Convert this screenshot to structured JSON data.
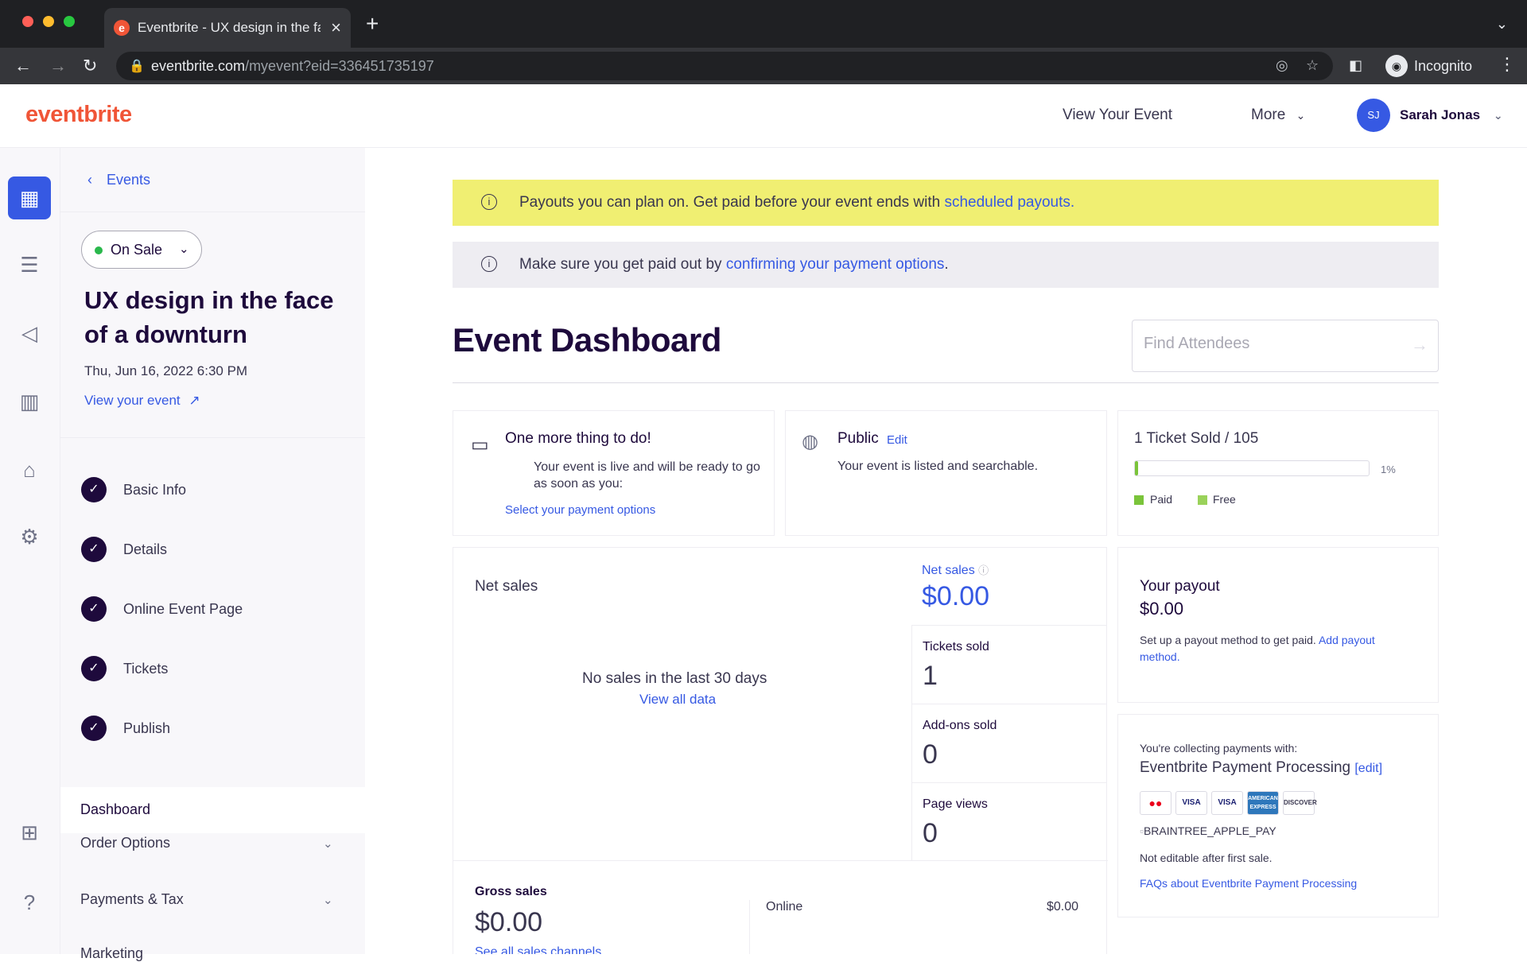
{
  "browser": {
    "tab_title": "Eventbrite - UX design in the face of a downturn",
    "tab_favicon": "e",
    "url_domain": "eventbrite.com",
    "url_path": "/myevent?eid=336451735197",
    "incognito_label": "Incognito"
  },
  "header": {
    "logo": "eventbrite",
    "view_event": "View Your Event",
    "more": "More",
    "user_initials": "SJ",
    "user_name": "Sarah Jonas"
  },
  "sidebar": {
    "back_label": "Events",
    "status": "On Sale",
    "event_title": "UX design in the face of a downturn",
    "event_date": "Thu, Jun 16, 2022 6:30 PM",
    "view_event_link": "View your event",
    "steps": [
      "Basic Info",
      "Details",
      "Online Event Page",
      "Tickets",
      "Publish"
    ],
    "nav": {
      "dashboard": "Dashboard",
      "order_options": "Order Options",
      "payments_tax": "Payments & Tax",
      "marketing": "Marketing"
    }
  },
  "banners": {
    "payouts_text": "Payouts you can plan on. Get paid before your event ends with ",
    "payouts_link": "scheduled payouts.",
    "confirm_text": "Make sure you get paid out by ",
    "confirm_link": "confirming your payment options",
    "confirm_end": "."
  },
  "dashboard": {
    "title": "Event Dashboard",
    "find_placeholder": "Find Attendees"
  },
  "todo_card": {
    "title": "One more thing to do!",
    "body": "Your event is live and will be ready to go as soon as you:",
    "link": "Select your payment options"
  },
  "public_card": {
    "title": "Public",
    "edit": "Edit",
    "body": "Your event is listed and searchable."
  },
  "tickets_card": {
    "title": "1 Ticket Sold / 105",
    "percent_label": "1%",
    "sold_fraction": 0.01,
    "legend_paid": "Paid",
    "legend_free": "Free",
    "color_paid": "#7ac43a",
    "color_free": "#9ad25a"
  },
  "sales_card": {
    "title": "Net sales",
    "empty": "No sales in the last 30 days",
    "view_all": "View all data",
    "net_sales_label": "Net sales",
    "net_sales_value": "$0.00",
    "tickets_sold_label": "Tickets sold",
    "tickets_sold_value": "1",
    "addons_label": "Add-ons sold",
    "addons_value": "0",
    "page_views_label": "Page views",
    "page_views_value": "0",
    "gross_label": "Gross sales",
    "gross_value": "$0.00",
    "gross_link": "See all sales channels",
    "online_label": "Online",
    "online_value": "$0.00"
  },
  "payout_card": {
    "title": "Your payout",
    "amount": "$0.00",
    "body": "Set up a payout method to get paid. ",
    "link": "Add payout method."
  },
  "processing_card": {
    "collecting": "You're collecting payments with:",
    "processor": "Eventbrite Payment Processing",
    "edit": "[edit]",
    "apple_pay_alt": "BRAINTREE_APPLE_PAY",
    "not_editable": "Not editable after first sale.",
    "faq_link": "FAQs about Eventbrite Payment Processing",
    "badges": [
      "MasterCard",
      "VISA",
      "VISA",
      "AMERICAN EXPRESS",
      "DISCOVER"
    ]
  },
  "colors": {
    "brand": "#f05537",
    "accent": "#3659e3",
    "banner_yellow": "#f0ef72",
    "banner_gray": "#eeedf2"
  }
}
